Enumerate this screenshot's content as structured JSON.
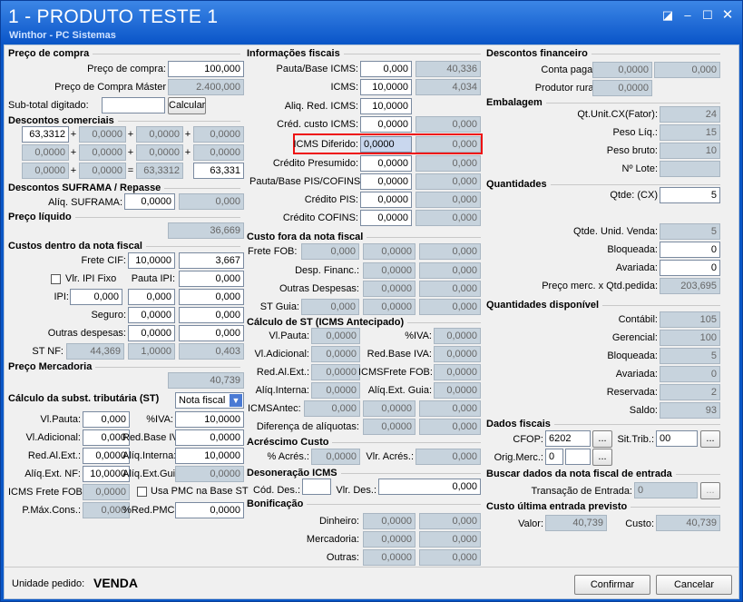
{
  "window": {
    "title": "1 - PRODUTO TESTE 1",
    "subtitle": "Winthor - PC Sistemas"
  },
  "compra": {
    "title": "Preço de compra",
    "preco_label": "Preço de compra:",
    "preco": "100,000",
    "master_label": "Preço de Compra Máster",
    "master": "2.400,000",
    "subtotal_label": "Sub-total digitado:",
    "subtotal": "",
    "calcular": "Calcular"
  },
  "descontos": {
    "title": "Descontos comerciais",
    "row1": [
      "63,3312",
      "0,0000",
      "0,0000",
      "0,0000"
    ],
    "row2": [
      "0,0000",
      "0,0000",
      "0,0000",
      "0,0000"
    ],
    "row3": [
      "0,0000",
      "0,0000",
      "63,3312",
      "63,331"
    ]
  },
  "suframa": {
    "title": "Descontos SUFRAMA / Repasse",
    "aliq_label": "Alíq. SUFRAMA:",
    "aliq": "0,0000",
    "aliq2": "0,000"
  },
  "liquido": {
    "title": "Preço líquido",
    "valor": "36,669"
  },
  "custos": {
    "title": "Custos dentro da nota fiscal",
    "frete_label": "Frete CIF:",
    "frete_pct": "10,0000",
    "frete_val": "3,667",
    "ipi_fixo": "Vlr. IPI Fixo",
    "pauta_ipi_label": "Pauta IPI:",
    "pauta_ipi": "0,000",
    "ipi_label": "IPI:",
    "ipi_pct": "0,000",
    "ipi_val": "0,000",
    "seguro_label": "Seguro:",
    "seguro_pct": "0,0000",
    "seguro_val": "0,000",
    "outras_label": "Outras despesas:",
    "outras_pct": "0,0000",
    "outras_val": "0,000",
    "st_label": "ST NF:",
    "st1": "44,369",
    "st2": "1,0000",
    "st3": "0,403"
  },
  "mercadoria": {
    "title": "Preço Mercadoria",
    "valor": "40,739"
  },
  "calc_st": {
    "title": "Cálculo da subst. tributária (ST)",
    "tipo": "Nota fiscal",
    "vlpauta_label": "Vl.Pauta:",
    "vlpauta": "0,000",
    "iva_label": "%IVA:",
    "iva": "10,0000",
    "vladic_label": "Vl.Adicional:",
    "vladic": "0,000",
    "redbase_label": "Red.Base IVA:",
    "redbase": "0,0000",
    "redalext_label": "Red.Al.Ext.:",
    "redalext": "0,0000",
    "aliqint_label": "Alíq.Interna:",
    "aliqint": "10,0000",
    "aliqextnf_label": "Alíq.Ext. NF:",
    "aliqextnf": "10,0000",
    "aliqextguia_label": "Alíq.Ext.Guia:",
    "aliqextguia": "0,0000",
    "icmsfrete_label": "ICMS Frete FOB:",
    "icmsfrete": "0,0000",
    "usapmc": "Usa PMC na Base ST",
    "pmax_label": "P.Máx.Cons.:",
    "pmax": "0,000",
    "redpmc_label": "%Red.PMC:",
    "redpmc": "0,0000"
  },
  "fiscais": {
    "title": "Informações fiscais",
    "pauta_label": "Pauta/Base ICMS:",
    "pauta": "0,000",
    "pauta2": "40,336",
    "icms_label": "ICMS:",
    "icms": "10,0000",
    "icms2": "4,034",
    "redicms_label": "Aliq. Red. ICMS:",
    "redicms": "10,0000",
    "credcusto_label": "Créd. custo ICMS:",
    "credcusto": "0,0000",
    "credcusto2": "0,000",
    "diferido_label": "ICMS Diferido:",
    "diferido": "0,0000",
    "diferido2": "0,000",
    "presumido_label": "Crédito Presumido:",
    "presumido": "0,0000",
    "presumido2": "0,000",
    "pautapis_label": "Pauta/Base PIS/COFINS:",
    "pautapis": "0,0000",
    "pautapis2": "0,000",
    "pis_label": "Crédito PIS:",
    "pis": "0,0000",
    "pis2": "0,000",
    "cofins_label": "Crédito COFINS:",
    "cofins": "0,0000",
    "cofins2": "0,000"
  },
  "custo_fora": {
    "title": "Custo fora da nota fiscal",
    "frete_label": "Frete FOB:",
    "frete": [
      "0,000",
      "0,0000",
      "0,000"
    ],
    "desp_label": "Desp. Financ.:",
    "desp": [
      "0,0000",
      "0,000"
    ],
    "outras_label": "Outras Despesas:",
    "outras": [
      "0,0000",
      "0,000"
    ],
    "guia_label": "ST Guia:",
    "guia": [
      "0,000",
      "0,0000",
      "0,000"
    ]
  },
  "st_antec": {
    "title": "Cálculo de ST (ICMS Antecipado)",
    "vlpauta_label": "Vl.Pauta:",
    "vlpauta": "0,0000",
    "iva_label": "%IVA:",
    "iva": "0,0000",
    "vladic_label": "Vl.Adicional:",
    "vladic": "0,0000",
    "redbase_label": "Red.Base IVA:",
    "redbase": "0,0000",
    "redalext_label": "Red.Al.Ext.:",
    "redalext": "0,0000",
    "icmsfrete_label": "ICMSFrete FOB:",
    "icmsfrete": "0,0000",
    "aliqint_label": "Alíq.Interna:",
    "aliqint": "0,0000",
    "aliqextguia_label": "Alíq.Ext. Guia:",
    "aliqextguia": "0,0000",
    "icmsantec_label": "ICMSAntec:",
    "icmsantec": "0,000",
    "icmsantec2": "0,0000",
    "icmsantec3": "0,000",
    "difaliq_label": "Diferença de alíquotas:",
    "difaliq1": "0,0000",
    "difaliq2": "0,000"
  },
  "acrescimo": {
    "title": "Acréscimo Custo",
    "acres_label": "% Acrés.:",
    "acres": "0,0000",
    "vlr_label": "Vlr. Acrés.:",
    "vlr": "0,000"
  },
  "desoneracao": {
    "title": "Desoneração ICMS",
    "cod_label": "Cód. Des.:",
    "cod": "",
    "vlr_label": "Vlr. Des.:",
    "vlr": "0,000"
  },
  "bonificacao": {
    "title": "Bonificação",
    "dinheiro_label": "Dinheiro:",
    "dinheiro": [
      "0,0000",
      "0,000"
    ],
    "mercadoria_label": "Mercadoria:",
    "mercadoria": [
      "0,0000",
      "0,000"
    ],
    "outras_label": "Outras:",
    "outras": [
      "0,0000",
      "0,000"
    ]
  },
  "financeiro": {
    "title": "Descontos financeiro",
    "conta_label": "Conta pagar:",
    "conta": "0,0000",
    "conta2": "0,000",
    "rural_label": "Produtor rural:",
    "rural": "0,0000"
  },
  "embalagem": {
    "title": "Embalagem",
    "qtunit_label": "Qt.Unit.CX(Fator):",
    "qtunit": "24",
    "pesoliq_label": "Peso Líq.:",
    "pesoliq": "15",
    "pesobruto_label": "Peso bruto:",
    "pesobruto": "10",
    "lote_label": "Nº Lote:",
    "lote": ""
  },
  "quantidades": {
    "title": "Quantidades",
    "qtde_label": "Qtde: (CX)",
    "qtde": "5",
    "unid_label": "Qtde. Unid. Venda:",
    "unid": "5",
    "bloqueada_label": "Bloqueada:",
    "bloqueada": "0",
    "avariada_label": "Avariada:",
    "avariada": "0",
    "precomerc_label": "Preço merc. x Qtd.pedida:",
    "precomerc": "203,695"
  },
  "disponivel": {
    "title": "Quantidades disponível",
    "contabil_label": "Contábil:",
    "contabil": "105",
    "gerencial_label": "Gerencial:",
    "gerencial": "100",
    "bloqueada_label": "Bloqueada:",
    "bloqueada": "5",
    "avariada_label": "Avariada:",
    "avariada": "0",
    "reservada_label": "Reservada:",
    "reservada": "2",
    "saldo_label": "Saldo:",
    "saldo": "93"
  },
  "dados_fiscais": {
    "title": "Dados fiscais",
    "cfop_label": "CFOP:",
    "cfop": "6202",
    "sittrib_label": "Sit.Trib.:",
    "sittrib": "00",
    "origmerc_label": "Orig.Merc.:",
    "origmerc": "0",
    "ellipsis": "..."
  },
  "buscar": {
    "title": "Buscar dados da nota fiscal de entrada",
    "transacao_label": "Transação de Entrada:",
    "transacao": "0"
  },
  "ultima": {
    "title": "Custo última entrada previsto",
    "valor_label": "Valor:",
    "valor": "40,739",
    "custo_label": "Custo:",
    "custo": "40,739"
  },
  "footer": {
    "unidade_label": "Unidade pedido:",
    "unidade": "VENDA",
    "confirmar": "Confirmar",
    "cancelar": "Cancelar"
  },
  "colors": {
    "highlight": "#e11111",
    "title_bg": "#0b56c9"
  }
}
